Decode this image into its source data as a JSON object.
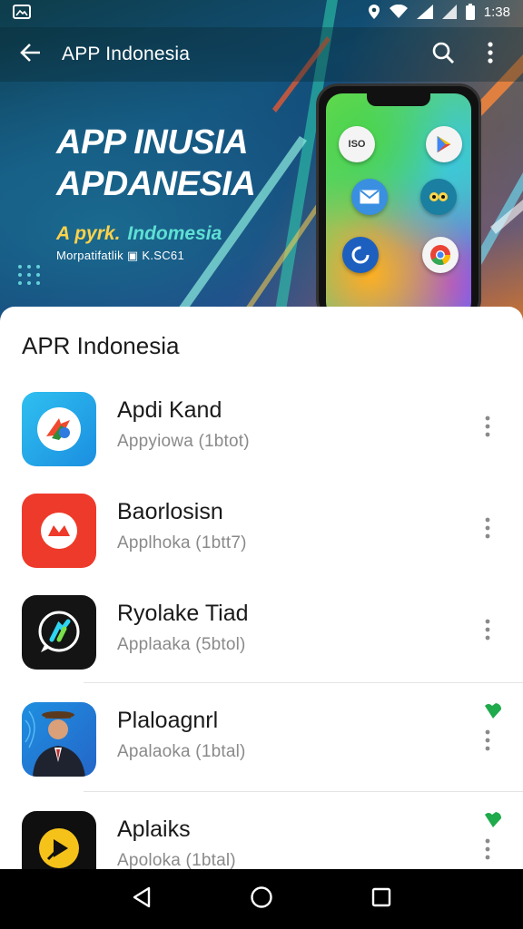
{
  "status_bar": {
    "time": "1:38"
  },
  "app_bar": {
    "title": "APP Indonesia",
    "search_icon": "search-icon",
    "more_icon": "more-vert-icon"
  },
  "banner": {
    "headline_line1": "APP INUSIA",
    "headline_line2": "APDANESIA",
    "tagline_part1": "A pyrk.",
    "tagline_part2": "Indomesia",
    "subtext": "Morpatifatlik ▣ K.SC61",
    "phone_icon_label": "ISO"
  },
  "sheet": {
    "title": "APR Indonesia",
    "apps": [
      {
        "name": "Apdi Kand",
        "meta": "Appyiowa  (1btot)",
        "icon": "feather-ball-icon",
        "icon_bg": "#2fa8e8",
        "pinned": false
      },
      {
        "name": "Baorlosisn",
        "meta": "Applhoka  (1btt7)",
        "icon": "crown-logo-icon",
        "icon_bg": "#ef3b2c",
        "pinned": false
      },
      {
        "name": "Ryolake Tiad",
        "meta": "Applaaka  (5btol)",
        "icon": "chat-bubble-icon",
        "icon_bg": "#141414",
        "pinned": false
      },
      {
        "name": "Plaloagnrl",
        "meta": "Apalaoka  (1btal)",
        "icon": "person-avatar-icon",
        "icon_bg": "#2b7fd8",
        "pinned": true
      },
      {
        "name": "Aplaiks",
        "meta": "Apoloka  (1btal)",
        "icon": "play-badge-icon",
        "icon_bg": "#0f0f0f",
        "pinned": true
      }
    ]
  },
  "colors": {
    "accent_green": "#1faa4b",
    "sheet_bg": "#ffffff",
    "nav_bg": "#000000"
  }
}
